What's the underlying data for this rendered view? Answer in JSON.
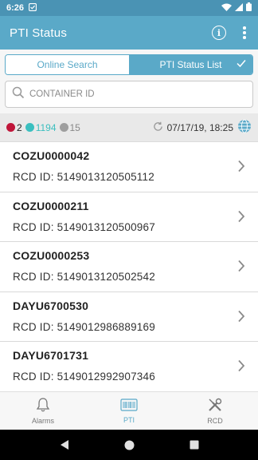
{
  "status_bar": {
    "time": "6:26",
    "icons": [
      "notification-icon",
      "wifi-icon",
      "signal-icon",
      "battery-icon"
    ]
  },
  "app_bar": {
    "title": "PTI Status",
    "icons": [
      "info-icon",
      "more-vert-icon"
    ]
  },
  "tabs": [
    {
      "label": "Online Search",
      "active": false
    },
    {
      "label": "PTI Status List",
      "active": true
    }
  ],
  "search": {
    "placeholder": "CONTAINER ID",
    "value": ""
  },
  "summary": {
    "counts": [
      {
        "value": "2",
        "color": "#c0163a"
      },
      {
        "value": "1194",
        "color": "#3bbfbf"
      },
      {
        "value": "15",
        "color": "#9e9e9e"
      }
    ],
    "timestamp": "07/17/19, 18:25",
    "icons": [
      "sync-icon",
      "globe-icon"
    ]
  },
  "containers": [
    {
      "id": "COZU0000042",
      "rcd": "RCD ID: 5149013120505112"
    },
    {
      "id": "COZU0000211",
      "rcd": "RCD ID: 5149013120500967"
    },
    {
      "id": "COZU0000253",
      "rcd": "RCD ID: 5149013120502542"
    },
    {
      "id": "DAYU6700530",
      "rcd": "RCD ID: 5149012986889169"
    },
    {
      "id": "DAYU6701731",
      "rcd": "RCD ID: 5149012992907346"
    }
  ],
  "bottom_nav": [
    {
      "label": "Alarms",
      "icon": "bell-icon",
      "active": false
    },
    {
      "label": "PTI",
      "icon": "barcode-icon",
      "active": true
    },
    {
      "label": "RCD",
      "icon": "tools-icon",
      "active": false
    }
  ],
  "colors": {
    "primary": "#5aa9c8",
    "status_bar": "#4a93b4",
    "alarm_red": "#c0163a",
    "ok_teal": "#3bbfbf",
    "grey": "#9e9e9e"
  }
}
